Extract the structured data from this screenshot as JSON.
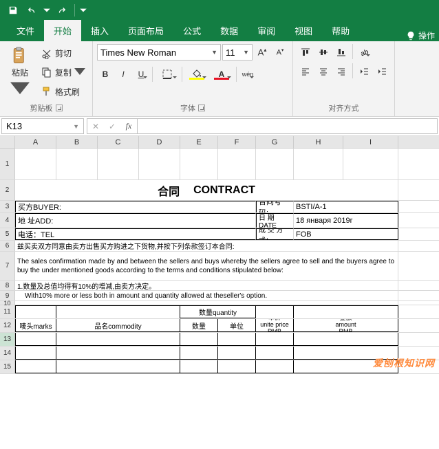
{
  "qat": {
    "save": "save",
    "undo": "undo",
    "redo": "redo"
  },
  "tabs": {
    "file": "文件",
    "home": "开始",
    "insert": "插入",
    "layout": "页面布局",
    "formulas": "公式",
    "data": "数据",
    "review": "审阅",
    "view": "视图",
    "help": "帮助",
    "tellme": "操作"
  },
  "ribbon": {
    "clipboard": {
      "paste": "粘贴",
      "cut": "剪切",
      "copy": "复制",
      "format_painter": "格式刷",
      "label": "剪贴板"
    },
    "font": {
      "name": "Times New Roman",
      "size": "11",
      "bold": "B",
      "italic": "I",
      "underline": "U",
      "phonetic": "wén",
      "label": "字体"
    },
    "align": {
      "label": "对齐方式"
    }
  },
  "namebox": "K13",
  "formula": "",
  "columns": [
    "A",
    "B",
    "C",
    "D",
    "E",
    "F",
    "G",
    "H",
    "I"
  ],
  "rows": [
    "1",
    "2",
    "3",
    "4",
    "5",
    "6",
    "7",
    "8",
    "9",
    "10",
    "11",
    "12",
    "13",
    "14",
    "15"
  ],
  "contract": {
    "title_cn": "合同",
    "title_en": "CONTRACT",
    "buyer_label": "买方BUYER:",
    "contract_no_label": "合同号码:",
    "contract_no": "BSTI/A-1",
    "address_label": "地 址ADD:",
    "date_label": "日   期DATE",
    "date_value": "18 января 2019г",
    "tel_label": "电话：TEL",
    "terms_label": "成 交 方 式：",
    "terms_value": "FOB",
    "intro_cn": "兹买卖双方同意由卖方出售买方购进之下货物,并按下列条款签订本合同:",
    "intro_en": "The sales confirmation made by and between the sellers and buys whereby the sellers agree to sell and the  buyers agree to buy the under mentioned goods according to the terms and conditions stipulated below:",
    "note_cn": "1.数量及总值均得有10%的增减,由卖方决定。",
    "note_en": "With10% more or less both in amount and quantity allowed at theseller's option.",
    "th_marks": "唛头marks",
    "th_commodity": "品名commodity",
    "th_quantity": "数量quantity",
    "th_qty": "数量",
    "th_unit": "单位",
    "th_price": "单价\nunite price\nRMB",
    "th_amount": "金额\namount\nRMB"
  },
  "watermark": "爱刨根知识网"
}
